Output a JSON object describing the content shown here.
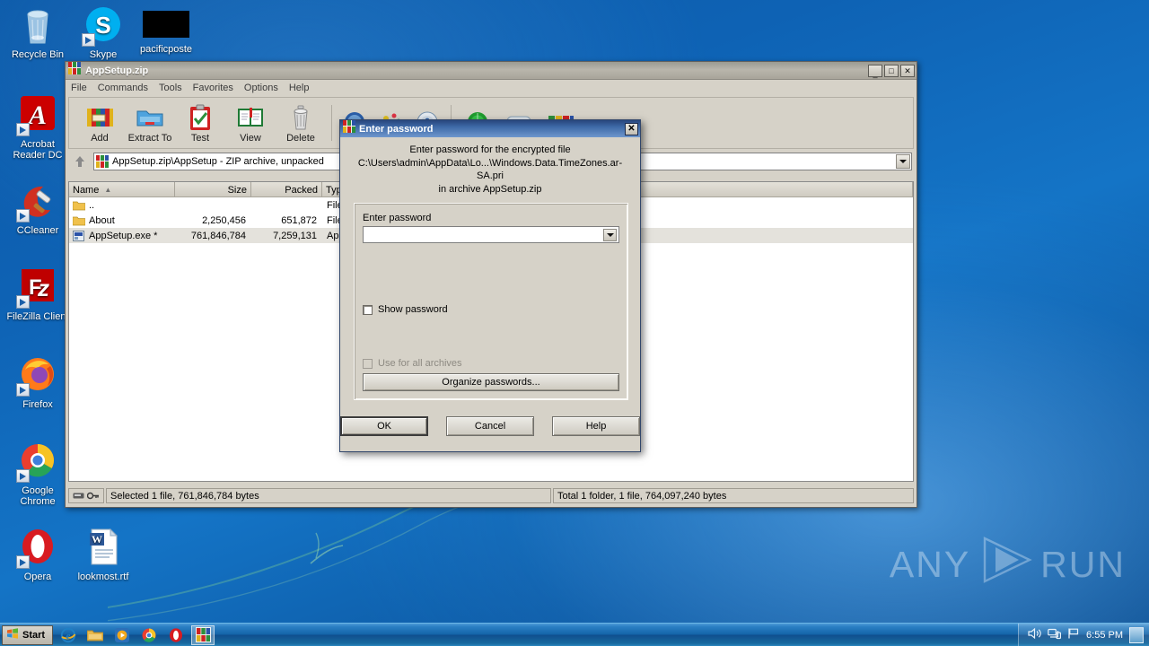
{
  "desktop": {
    "icons": [
      {
        "name": "recycle-bin",
        "label": "Recycle Bin",
        "shortcut": false
      },
      {
        "name": "skype",
        "label": "Skype",
        "shortcut": true
      },
      {
        "name": "pacificposte",
        "label": "pacificposte",
        "shortcut": false
      },
      {
        "name": "acrobat-reader-dc",
        "label": "Acrobat Reader DC",
        "shortcut": true
      },
      {
        "name": "ccleaner",
        "label": "CCleaner",
        "shortcut": true
      },
      {
        "name": "filezilla-client",
        "label": "FileZilla Client",
        "shortcut": true
      },
      {
        "name": "firefox",
        "label": "Firefox",
        "shortcut": true
      },
      {
        "name": "google-chrome",
        "label": "Google Chrome",
        "shortcut": true
      },
      {
        "name": "opera",
        "label": "Opera",
        "shortcut": true
      },
      {
        "name": "lookmost-rtf",
        "label": "lookmost.rtf",
        "shortcut": false
      }
    ],
    "watermark": {
      "left": "ANY",
      "right": "RUN"
    }
  },
  "winrar": {
    "title": "AppSetup.zip",
    "window_buttons": {
      "minimize": "_",
      "maximize": "□",
      "close": "×"
    },
    "menu": [
      "File",
      "Commands",
      "Tools",
      "Favorites",
      "Options",
      "Help"
    ],
    "toolbar": [
      {
        "name": "add",
        "label": "Add"
      },
      {
        "name": "extract-to",
        "label": "Extract To"
      },
      {
        "name": "test",
        "label": "Test"
      },
      {
        "name": "view",
        "label": "View"
      },
      {
        "name": "delete",
        "label": "Delete"
      },
      {
        "name": "find",
        "label": ""
      },
      {
        "name": "wizard",
        "label": ""
      },
      {
        "name": "info",
        "label": ""
      },
      {
        "name": "virusscan",
        "label": ""
      },
      {
        "name": "comment",
        "label": ""
      },
      {
        "name": "sfx",
        "label": ""
      }
    ],
    "address": {
      "up_tooltip": "Up One Level",
      "path": "AppSetup.zip\\AppSetup - ZIP archive, unpacked"
    },
    "columns": [
      "Name",
      "Size",
      "Packed",
      "Type"
    ],
    "rows": [
      {
        "name": "..",
        "size": "",
        "packed": "",
        "type": "File ",
        "icon": "folder",
        "selected": false
      },
      {
        "name": "About",
        "size": "2,250,456",
        "packed": "651,872",
        "type": "File ",
        "icon": "folder",
        "selected": false
      },
      {
        "name": "AppSetup.exe *",
        "size": "761,846,784",
        "packed": "7,259,131",
        "type": "Appl",
        "icon": "exe",
        "selected": true
      }
    ],
    "status": {
      "left": "Selected 1 file, 761,846,784 bytes",
      "right": "Total 1 folder, 1 file, 764,097,240 bytes"
    }
  },
  "dialog": {
    "title": "Enter password",
    "close_label": "×",
    "message_line1": "Enter password for the encrypted file",
    "message_line2": "C:\\Users\\admin\\AppData\\Lo...\\Windows.Data.TimeZones.ar-SA.pri",
    "message_line3": "in archive AppSetup.zip",
    "field_label": "Enter password",
    "password_value": "",
    "show_password_label": "Show password",
    "show_password_checked": false,
    "use_for_all_label": "Use for all archives",
    "use_for_all_checked": false,
    "use_for_all_disabled": true,
    "organize_label": "Organize passwords...",
    "buttons": {
      "ok": "OK",
      "cancel": "Cancel",
      "help": "Help"
    }
  },
  "taskbar": {
    "start_label": "Start",
    "tasks": [
      {
        "name": "internet-explorer",
        "active": false
      },
      {
        "name": "windows-explorer",
        "active": false
      },
      {
        "name": "windows-media-player",
        "active": false
      },
      {
        "name": "google-chrome",
        "active": false
      },
      {
        "name": "opera",
        "active": false
      },
      {
        "name": "winrar",
        "active": true
      }
    ],
    "tray": {
      "volume": "volume-icon",
      "network": "network-icon",
      "flag": "action-center-icon",
      "clock": "6:55 PM"
    }
  }
}
